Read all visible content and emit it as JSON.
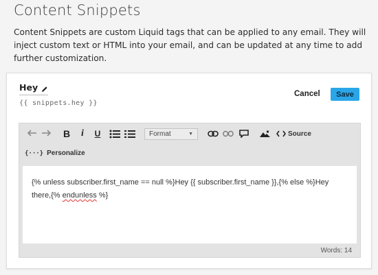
{
  "page": {
    "title": "Content Snippets",
    "intro": "Content Snippets are custom Liquid tags that can be applied to any email. They will inject custom text or HTML into your email, and can be updated at any time to add further customization."
  },
  "snippet": {
    "name": "Hey",
    "tag": "{{ snippets.hey }}"
  },
  "actions": {
    "cancel_label": "Cancel",
    "save_label": "Save",
    "save_color": "#2aa6e8"
  },
  "toolbar": {
    "undo_icon": "undo-icon",
    "redo_icon": "redo-icon",
    "bold_label": "B",
    "italic_label": "i",
    "underline_label": "U",
    "format_selected": "Format",
    "source_label": "Source"
  },
  "personalize": {
    "icon_text": "{···}",
    "label": "Personalize"
  },
  "content": {
    "line1": "{% unless subscriber.first_name == null %}Hey {{ subscriber.first_name }},{% else %}Hey",
    "line2_prefix": "there,{% ",
    "line2_spell": "endunless",
    "line2_suffix": " %}"
  },
  "footer": {
    "word_count": "Words: 14"
  }
}
